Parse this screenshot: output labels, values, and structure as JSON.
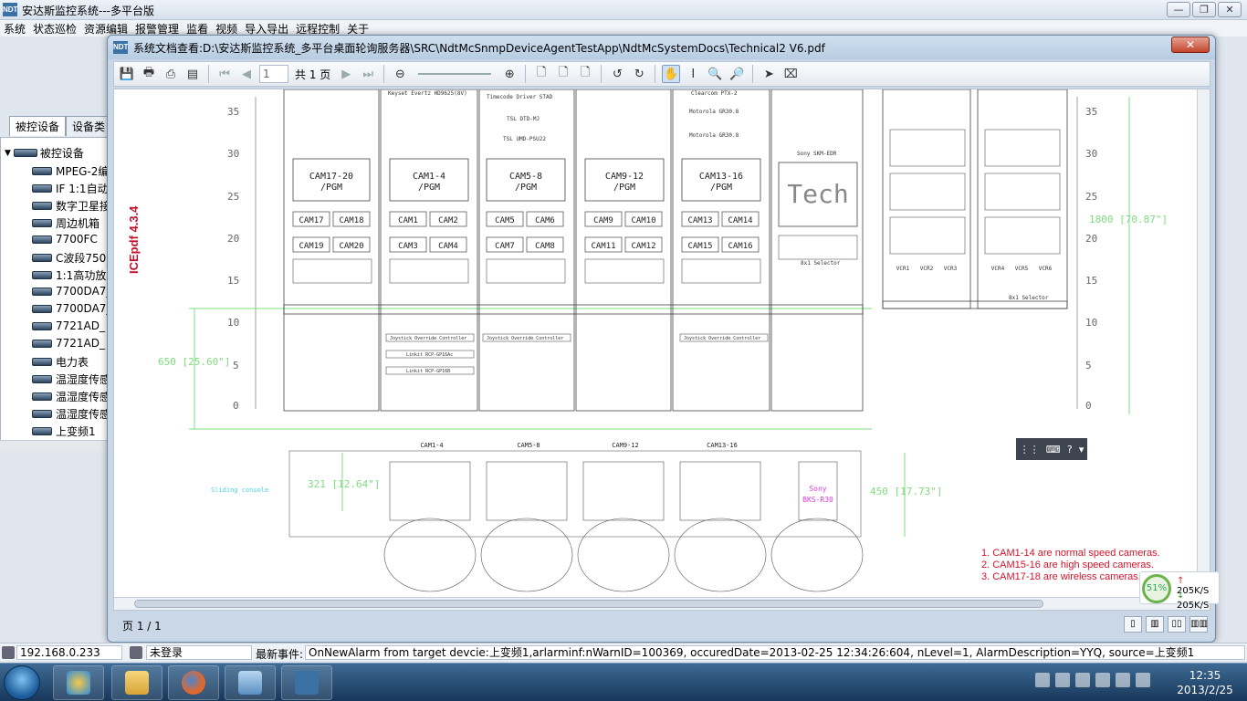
{
  "app": {
    "title": "安达斯监控系统---多平台版",
    "menu": [
      "系统",
      "状态巡检",
      "资源编辑",
      "报警管理",
      "监看",
      "视频",
      "导入导出",
      "远程控制",
      "关于"
    ]
  },
  "left_panel": {
    "tabs": [
      "被控设备",
      "设备类"
    ],
    "root": "被控设备",
    "items": [
      "MPEG-2编",
      "IF 1:1自动",
      "数字卫星接",
      "周边机箱",
      "7700FC",
      "C波段750",
      "1:1高功放",
      "7700DA7_",
      "7700DA7_",
      "7721AD_",
      "7721AD_",
      "电力表",
      "温湿度传感",
      "温湿度传感",
      "温湿度传感",
      "上变频1"
    ]
  },
  "viewer": {
    "title": "系统文档查看:D:\\安达斯监控系统_多平台桌面轮询服务器\\SRC\\NdtMcSnmpDeviceAgentTestApp\\NdtMcSystemDocs\\Technical2 V6.pdf",
    "close": "✕",
    "page_current": "1",
    "page_total": "共 1 页",
    "status": "页 1 / 1",
    "watermark": "ICEpdf 4.3.4"
  },
  "drawing": {
    "scale_left": [
      "35",
      "30",
      "25",
      "20",
      "15",
      "10",
      "5",
      "0"
    ],
    "scale_right": [
      "35",
      "30",
      "25",
      "20",
      "15",
      "10",
      "5",
      "0"
    ],
    "dim_left": "650 [25.60\"]",
    "dim_right": "1800 [70.87\"]",
    "dim_console": "321 [12.64\"]",
    "dim_console_right": "450 [17.73\"]",
    "sliding": "Sliding console",
    "pgm_labels": [
      "CAM17-20\n/PGM",
      "CAM1-4\n/PGM",
      "CAM5-8\n/PGM",
      "CAM9-12\n/PGM",
      "CAM13-16\n/PGM"
    ],
    "tech": "Tech",
    "cam_grid": [
      [
        "CAM17",
        "CAM18",
        "CAM19",
        "CAM20"
      ],
      [
        "CAM1",
        "CAM2",
        "CAM3",
        "CAM4"
      ],
      [
        "CAM5",
        "CAM6",
        "CAM7",
        "CAM8"
      ],
      [
        "CAM9",
        "CAM10",
        "CAM11",
        "CAM12"
      ],
      [
        "CAM13",
        "CAM14",
        "CAM15",
        "CAM16"
      ]
    ],
    "top_labels": [
      "Keyset Evertz HD9625(8V)",
      "Timecode Driver STAD",
      "",
      "Clearcom PTX-2"
    ],
    "tsl": [
      "TSL DTD-MJ",
      "TSL UMD-PSU22"
    ],
    "motorola": [
      "Motorola GR30.8",
      "Motorola GR30.8"
    ],
    "joystick": "Joystick Override Controller",
    "linkit": [
      "Linkit RCP-GP16Ac",
      "Linkit RCP-GP16B"
    ],
    "sony": "Sony SKM-EDR",
    "selector": "8x1 Selector",
    "vcr": [
      "VCR1",
      "VCR2",
      "VCR3",
      "VCR4",
      "VCR5",
      "VCR6"
    ],
    "console_groups": [
      "CAM1-4",
      "CAM5-8",
      "CAM9-12",
      "CAM13-16"
    ],
    "sony_small": [
      "Sony",
      "BKS-R30"
    ]
  },
  "notes": [
    "1. CAM1-14 are normal speed cameras.",
    "2. CAM15-16 are high speed cameras.",
    "3. CAM17-18 are wireless cameras."
  ],
  "net": {
    "percent": "51%",
    "up": "205K/S",
    "down": "205K/S"
  },
  "status_bar": {
    "ip": "192.168.0.233",
    "login": "未登录",
    "event_label": "最新事件:",
    "event": "OnNewAlarm from target devcie:上变频1,arlarminf:nWarnID=100369, occuredDate=2013-02-25 12:34:26:604, nLevel=1, AlarmDescription=YYQ, source=上变频1"
  },
  "clock": {
    "time": "12:35",
    "date": "2013/2/25"
  },
  "colors": {
    "accent": "#c0102a",
    "green": "#7fdc7f",
    "cyan": "#4fd0e6",
    "magenta": "#d63fd6"
  }
}
